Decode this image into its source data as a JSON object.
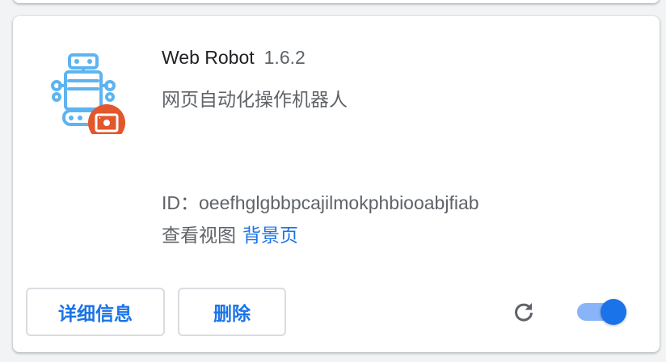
{
  "extension": {
    "name": "Web Robot",
    "version": "1.6.2",
    "description": "网页自动化操作机器人",
    "id_text": "ID：oeefhglgbbpcajilmokphbiooabjfiab",
    "views_label": "查看视图",
    "background_page_link": "背景页",
    "enabled": true
  },
  "buttons": {
    "details": "详细信息",
    "remove": "删除"
  },
  "icons": {
    "extension_icon": "robot-icon",
    "badge": "unpacked-extension-badge-icon",
    "reload": "reload-icon"
  },
  "colors": {
    "accent": "#1a73e8",
    "robot": "#5eb4f0",
    "badge": "#e2572c",
    "toggle_track": "#8ab4f8"
  }
}
